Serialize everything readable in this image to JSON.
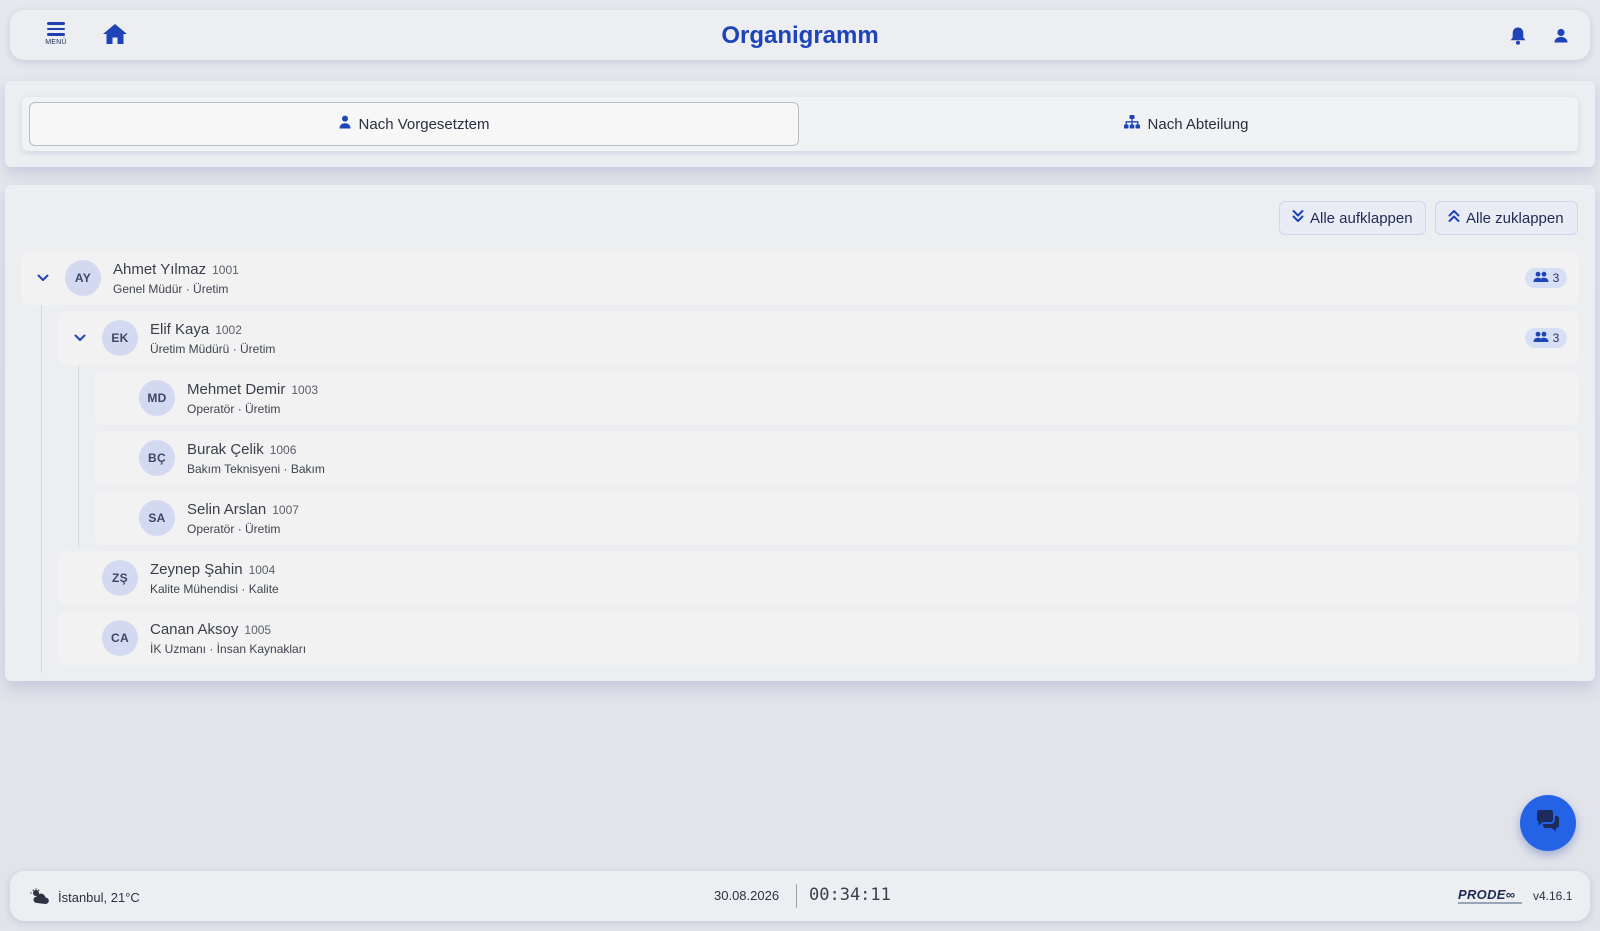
{
  "header": {
    "menu_label": "MENÜ",
    "title": "Organigramm"
  },
  "tabs": [
    {
      "label": "Nach Vorgesetztem",
      "icon": "person-icon",
      "active": true
    },
    {
      "label": "Nach Abteilung",
      "icon": "org-chart-icon",
      "active": false
    }
  ],
  "controls": {
    "expand_all": "Alle aufklappen",
    "collapse_all": "Alle zuklappen"
  },
  "tree": [
    {
      "initials": "AY",
      "name": "Ahmet Yılmaz",
      "id": "1001",
      "subtitle": "Genel Müdür · Üretim",
      "reports": "3",
      "expanded": true,
      "level": 0
    },
    {
      "initials": "EK",
      "name": "Elif Kaya",
      "id": "1002",
      "subtitle": "Üretim Müdürü · Üretim",
      "reports": "3",
      "expanded": true,
      "level": 1
    },
    {
      "initials": "MD",
      "name": "Mehmet Demir",
      "id": "1003",
      "subtitle": "Operatör · Üretim",
      "level": 2
    },
    {
      "initials": "BÇ",
      "name": "Burak Çelik",
      "id": "1006",
      "subtitle": "Bakım Teknisyeni · Bakım",
      "level": 2
    },
    {
      "initials": "SA",
      "name": "Selin Arslan",
      "id": "1007",
      "subtitle": "Operatör · Üretim",
      "level": 2
    },
    {
      "initials": "ZŞ",
      "name": "Zeynep Şahin",
      "id": "1004",
      "subtitle": "Kalite Mühendisi · Kalite",
      "level": 1
    },
    {
      "initials": "CA",
      "name": "Canan Aksoy",
      "id": "1005",
      "subtitle": "İK Uzmanı · İnsan Kaynakları",
      "level": 1
    }
  ],
  "footer": {
    "weather": "İstanbul, 21°C",
    "date": "30.08.2026",
    "time": "00:34:11",
    "logo": "PRODE∞",
    "version": "v4.16.1"
  },
  "colors": {
    "accent": "#1e44b8",
    "chat_fab": "#2563e6",
    "avatar_bg": "#d2d9f0"
  }
}
